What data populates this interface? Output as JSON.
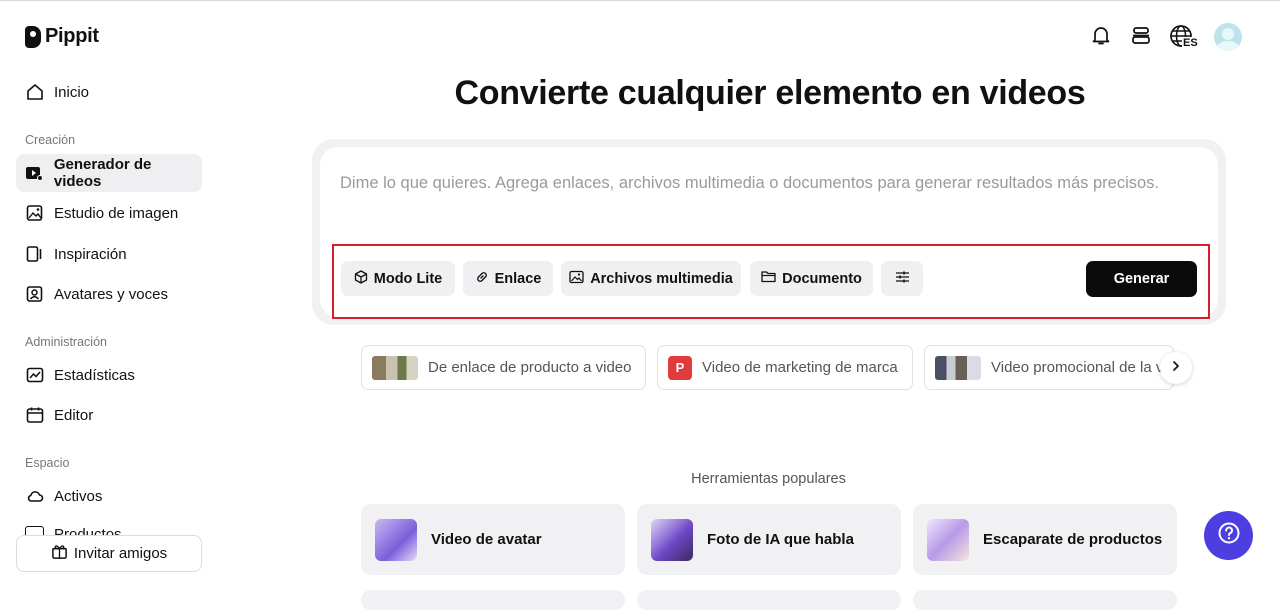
{
  "app": {
    "name": "Pippit"
  },
  "sidebar": {
    "home": "Inicio",
    "sections": [
      {
        "label": "Creación",
        "items": [
          "Generador de videos",
          "Estudio de imagen",
          "Inspiración",
          "Avatares y voces"
        ]
      },
      {
        "label": "Administración",
        "items": [
          "Estadísticas",
          "Editor"
        ]
      },
      {
        "label": "Espacio",
        "items": [
          "Activos",
          "Productos"
        ]
      }
    ],
    "invite": "Invitar amigos"
  },
  "header": {
    "language_badge": "ES"
  },
  "main": {
    "title": "Convierte cualquier elemento en videos",
    "prompt_placeholder": "Dime lo que quieres. Agrega enlaces, archivos multimedia o documentos para generar resultados más precisos.",
    "toolbar": {
      "mode": "Modo Lite",
      "link": "Enlace",
      "media": "Archivos multimedia",
      "document": "Documento",
      "generate": "Generar"
    },
    "suggestions": [
      {
        "label": "De enlace de producto a video"
      },
      {
        "label": "Video de marketing de marca",
        "badge": "P"
      },
      {
        "label": "Video promocional de la v"
      }
    ],
    "popular_title": "Herramientas populares",
    "tools": [
      "Video de avatar",
      "Foto de IA que habla",
      "Escaparate de productos"
    ]
  },
  "colors": {
    "accent": "#4c3ee0",
    "highlight": "#d71f2b",
    "badge_red": "#e03a3a"
  }
}
